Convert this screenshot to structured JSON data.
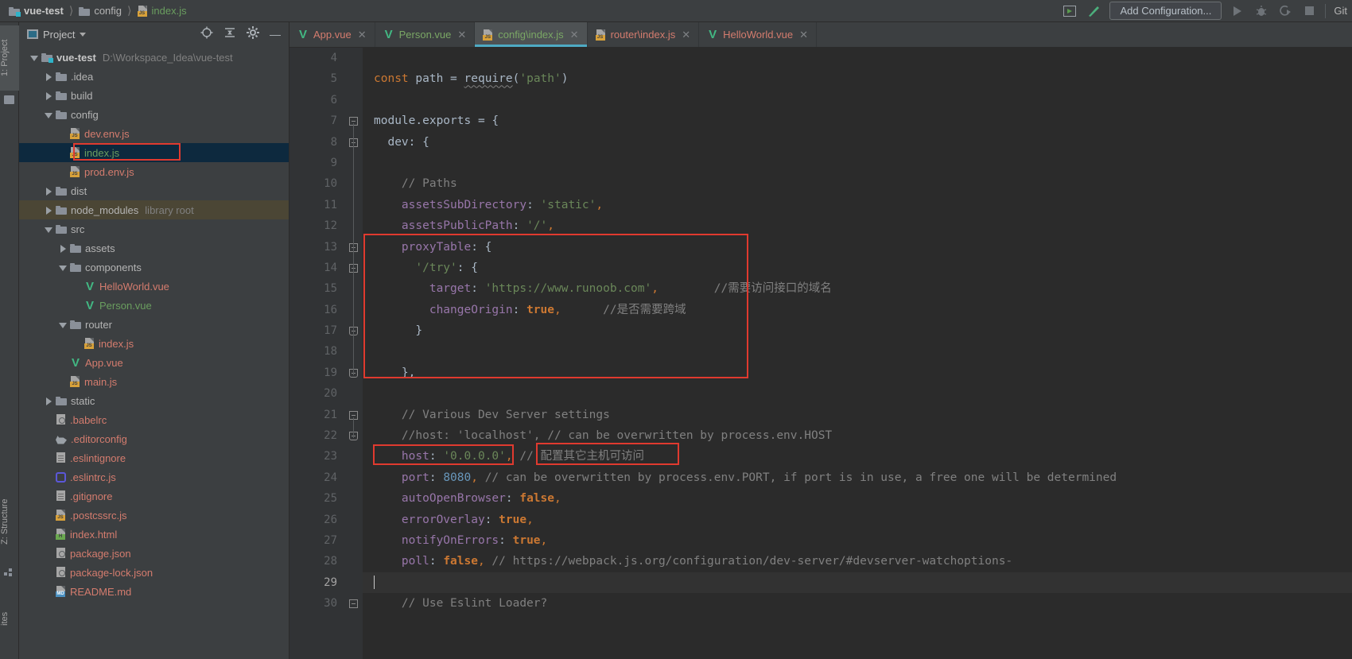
{
  "window": {
    "breadcrumb": [
      {
        "label": "vue-test",
        "icon": "folder-module-icon",
        "style": "bold"
      },
      {
        "label": "config",
        "icon": "folder-icon",
        "style": "normal"
      },
      {
        "label": "index.js",
        "icon": "js-file-icon",
        "style": "js"
      }
    ]
  },
  "toolbar": {
    "icons": [
      "run-dashboard-icon",
      "build-hammer-icon"
    ],
    "add_configuration_label": "Add Configuration...",
    "run_icon": "run-icon",
    "debug_icon": "debug-bug-icon",
    "coverage_icon": "run-with-coverage-icon",
    "stop_icon": "stop-icon",
    "git_label": "Git"
  },
  "left_strip": {
    "project_tab": "1: Project",
    "structure_tab": "Z: Structure",
    "favorites_tab": "ites"
  },
  "project_panel": {
    "title": "Project",
    "icons": [
      "locate-icon",
      "collapse-all-icon",
      "settings-gear-icon",
      "hide-icon"
    ],
    "tree": [
      {
        "depth": 0,
        "twisty": "open",
        "icon": "module-folder-icon",
        "label": "vue-test",
        "style": "dir-bold",
        "sub": "D:\\Workspace_Idea\\vue-test"
      },
      {
        "depth": 1,
        "twisty": "closed",
        "icon": "folder-icon",
        "label": ".idea",
        "style": "dir"
      },
      {
        "depth": 1,
        "twisty": "closed",
        "icon": "folder-icon",
        "label": "build",
        "style": "dir"
      },
      {
        "depth": 1,
        "twisty": "open",
        "icon": "folder-icon",
        "label": "config",
        "style": "dir"
      },
      {
        "depth": 2,
        "twisty": "none",
        "icon": "js-file-icon",
        "label": "dev.env.js",
        "style": "red"
      },
      {
        "depth": 2,
        "twisty": "none",
        "icon": "js-file-icon",
        "label": "index.js",
        "style": "green",
        "selected": true,
        "highlighted": true
      },
      {
        "depth": 2,
        "twisty": "none",
        "icon": "js-file-icon",
        "label": "prod.env.js",
        "style": "red"
      },
      {
        "depth": 1,
        "twisty": "closed",
        "icon": "folder-icon",
        "label": "dist",
        "style": "dir"
      },
      {
        "depth": 1,
        "twisty": "closed",
        "icon": "folder-icon",
        "label": "node_modules",
        "style": "dir",
        "sub": "library root",
        "library": true
      },
      {
        "depth": 1,
        "twisty": "open",
        "icon": "folder-icon",
        "label": "src",
        "style": "dir"
      },
      {
        "depth": 2,
        "twisty": "closed",
        "icon": "folder-icon",
        "label": "assets",
        "style": "dir"
      },
      {
        "depth": 2,
        "twisty": "open",
        "icon": "folder-icon",
        "label": "components",
        "style": "dir"
      },
      {
        "depth": 3,
        "twisty": "none",
        "icon": "vue-file-icon",
        "label": "HelloWorld.vue",
        "style": "red"
      },
      {
        "depth": 3,
        "twisty": "none",
        "icon": "vue-file-icon",
        "label": "Person.vue",
        "style": "green"
      },
      {
        "depth": 2,
        "twisty": "open",
        "icon": "folder-icon",
        "label": "router",
        "style": "dir"
      },
      {
        "depth": 3,
        "twisty": "none",
        "icon": "js-file-icon",
        "label": "index.js",
        "style": "red"
      },
      {
        "depth": 2,
        "twisty": "none",
        "icon": "vue-file-icon",
        "label": "App.vue",
        "style": "red"
      },
      {
        "depth": 2,
        "twisty": "none",
        "icon": "js-file-icon",
        "label": "main.js",
        "style": "red"
      },
      {
        "depth": 1,
        "twisty": "closed",
        "icon": "folder-icon",
        "label": "static",
        "style": "dir"
      },
      {
        "depth": 1,
        "twisty": "none",
        "icon": "json-file-icon",
        "label": ".babelrc",
        "style": "red"
      },
      {
        "depth": 1,
        "twisty": "none",
        "icon": "editorconfig-icon",
        "label": ".editorconfig",
        "style": "red"
      },
      {
        "depth": 1,
        "twisty": "none",
        "icon": "text-file-icon",
        "label": ".eslintignore",
        "style": "red"
      },
      {
        "depth": 1,
        "twisty": "none",
        "icon": "eslint-icon",
        "label": ".eslintrc.js",
        "style": "red"
      },
      {
        "depth": 1,
        "twisty": "none",
        "icon": "text-file-icon",
        "label": ".gitignore",
        "style": "red"
      },
      {
        "depth": 1,
        "twisty": "none",
        "icon": "js-file-icon",
        "label": ".postcssrc.js",
        "style": "red"
      },
      {
        "depth": 1,
        "twisty": "none",
        "icon": "html-file-icon",
        "label": "index.html",
        "style": "red"
      },
      {
        "depth": 1,
        "twisty": "none",
        "icon": "json-file-icon",
        "label": "package.json",
        "style": "red"
      },
      {
        "depth": 1,
        "twisty": "none",
        "icon": "json-file-icon",
        "label": "package-lock.json",
        "style": "red"
      },
      {
        "depth": 1,
        "twisty": "none",
        "icon": "md-file-icon",
        "label": "README.md",
        "style": "red"
      }
    ]
  },
  "editor": {
    "tabs": [
      {
        "label": "App.vue",
        "icon": "vue-file-icon",
        "color": "red",
        "active": false
      },
      {
        "label": "Person.vue",
        "icon": "vue-file-icon",
        "color": "green",
        "active": false
      },
      {
        "label": "config\\index.js",
        "icon": "js-file-icon",
        "color": "green",
        "active": true
      },
      {
        "label": "router\\index.js",
        "icon": "js-file-icon",
        "color": "red",
        "active": false
      },
      {
        "label": "HelloWorld.vue",
        "icon": "vue-file-icon",
        "color": "red",
        "active": false
      }
    ],
    "close_glyph": "✕",
    "first_line_number": 4,
    "lines": [
      {
        "num": 4,
        "tokens": []
      },
      {
        "num": 5,
        "tokens": [
          {
            "t": "const ",
            "c": "k"
          },
          {
            "t": "path ",
            "c": "d"
          },
          {
            "t": "= ",
            "c": "d"
          },
          {
            "t": "require",
            "c": "d wavy"
          },
          {
            "t": "(",
            "c": "d"
          },
          {
            "t": "'path'",
            "c": "s"
          },
          {
            "t": ")",
            "c": "d"
          }
        ]
      },
      {
        "num": 6,
        "tokens": []
      },
      {
        "num": 7,
        "tokens": [
          {
            "t": "module.exports = {",
            "c": "d"
          }
        ],
        "fold": "open"
      },
      {
        "num": 8,
        "tokens": [
          {
            "t": "  dev: {",
            "c": "d"
          }
        ],
        "fold": "open"
      },
      {
        "num": 9,
        "tokens": []
      },
      {
        "num": 10,
        "tokens": [
          {
            "t": "    // Paths",
            "c": "c"
          }
        ]
      },
      {
        "num": 11,
        "tokens": [
          {
            "t": "    assetsSubDirectory",
            "c": "p"
          },
          {
            "t": ": ",
            "c": "d"
          },
          {
            "t": "'static'",
            "c": "s"
          },
          {
            "t": ",",
            "c": "o"
          }
        ]
      },
      {
        "num": 12,
        "tokens": [
          {
            "t": "    assetsPublicPath",
            "c": "p"
          },
          {
            "t": ": ",
            "c": "d"
          },
          {
            "t": "'/'",
            "c": "s"
          },
          {
            "t": ",",
            "c": "o"
          }
        ]
      },
      {
        "num": 13,
        "tokens": [
          {
            "t": "    proxyTable",
            "c": "p"
          },
          {
            "t": ": {",
            "c": "d"
          }
        ],
        "fold": "open"
      },
      {
        "num": 14,
        "tokens": [
          {
            "t": "      ",
            "c": "d"
          },
          {
            "t": "'/try'",
            "c": "s"
          },
          {
            "t": ": {",
            "c": "d"
          }
        ],
        "fold": "open"
      },
      {
        "num": 15,
        "tokens": [
          {
            "t": "        target",
            "c": "p"
          },
          {
            "t": ": ",
            "c": "d"
          },
          {
            "t": "'https://www.runoob.com'",
            "c": "s"
          },
          {
            "t": ",",
            "c": "o"
          },
          {
            "t": "        //需要访问接口的域名",
            "c": "c"
          }
        ]
      },
      {
        "num": 16,
        "tokens": [
          {
            "t": "        changeOrigin",
            "c": "p"
          },
          {
            "t": ": ",
            "c": "d"
          },
          {
            "t": "true",
            "c": "b"
          },
          {
            "t": ",",
            "c": "o"
          },
          {
            "t": "      //是否需要跨域",
            "c": "c"
          }
        ]
      },
      {
        "num": 17,
        "tokens": [
          {
            "t": "      }",
            "c": "d"
          }
        ],
        "fold": "close"
      },
      {
        "num": 18,
        "tokens": []
      },
      {
        "num": 19,
        "tokens": [
          {
            "t": "    },",
            "c": "d"
          }
        ],
        "fold": "close"
      },
      {
        "num": 20,
        "tokens": []
      },
      {
        "num": 21,
        "tokens": [
          {
            "t": "    // Various Dev Server settings",
            "c": "c"
          }
        ],
        "fold": "open"
      },
      {
        "num": 22,
        "tokens": [
          {
            "t": "    //host: 'localhost', // can be overwritten by process.env.HOST",
            "c": "c"
          }
        ],
        "fold": "close"
      },
      {
        "num": 23,
        "tokens": [
          {
            "t": "    host",
            "c": "p"
          },
          {
            "t": ": ",
            "c": "d"
          },
          {
            "t": "'0.0.0.0'",
            "c": "s"
          },
          {
            "t": ",",
            "c": "o"
          },
          {
            "t": " // ",
            "c": "c"
          },
          {
            "t": "配置其它主机可访问",
            "c": "c"
          }
        ]
      },
      {
        "num": 24,
        "tokens": [
          {
            "t": "    port",
            "c": "p"
          },
          {
            "t": ": ",
            "c": "d"
          },
          {
            "t": "8080",
            "c": "n"
          },
          {
            "t": ",",
            "c": "o"
          },
          {
            "t": " // can be overwritten by process.env.PORT, if port is in use, a free one will be determined",
            "c": "c"
          }
        ]
      },
      {
        "num": 25,
        "tokens": [
          {
            "t": "    autoOpenBrowser",
            "c": "p"
          },
          {
            "t": ": ",
            "c": "d"
          },
          {
            "t": "false",
            "c": "b"
          },
          {
            "t": ",",
            "c": "o"
          }
        ]
      },
      {
        "num": 26,
        "tokens": [
          {
            "t": "    errorOverlay",
            "c": "p"
          },
          {
            "t": ": ",
            "c": "d"
          },
          {
            "t": "true",
            "c": "b"
          },
          {
            "t": ",",
            "c": "o"
          }
        ]
      },
      {
        "num": 27,
        "tokens": [
          {
            "t": "    notifyOnErrors",
            "c": "p"
          },
          {
            "t": ": ",
            "c": "d"
          },
          {
            "t": "true",
            "c": "b"
          },
          {
            "t": ",",
            "c": "o"
          }
        ]
      },
      {
        "num": 28,
        "tokens": [
          {
            "t": "    poll",
            "c": "p"
          },
          {
            "t": ": ",
            "c": "d"
          },
          {
            "t": "false",
            "c": "b"
          },
          {
            "t": ",",
            "c": "o"
          },
          {
            "t": " // https://webpack.js.org/configuration/dev-server/#devserver-watchoptions-",
            "c": "c"
          }
        ]
      },
      {
        "num": 29,
        "tokens": [],
        "caret": true,
        "current": true
      },
      {
        "num": 30,
        "tokens": [
          {
            "t": "    // Use Eslint Loader?",
            "c": "c"
          }
        ],
        "fold": "open"
      }
    ]
  },
  "annotations": {
    "color": "#e03a2f",
    "boxes": [
      "sidebar-index-js",
      "proxy-table-block",
      "host-value",
      "host-comment"
    ]
  }
}
